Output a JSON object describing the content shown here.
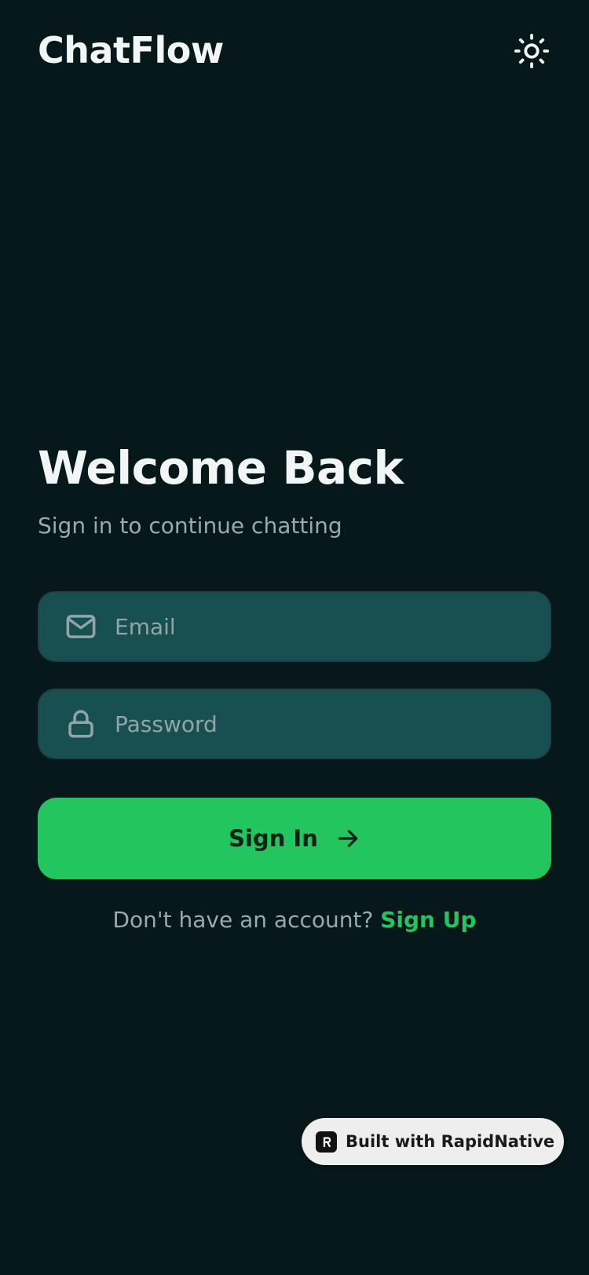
{
  "header": {
    "app_title": "ChatFlow",
    "theme_icon": "sun-icon"
  },
  "welcome": {
    "title": "Welcome Back",
    "subtitle": "Sign in to continue chatting"
  },
  "form": {
    "email": {
      "placeholder": "Email",
      "value": "",
      "icon": "mail-icon"
    },
    "password": {
      "placeholder": "Password",
      "value": "",
      "icon": "lock-icon"
    },
    "submit_label": "Sign In",
    "submit_icon": "arrow-right-icon"
  },
  "signup": {
    "prompt": "Don't have an account?",
    "link_label": "Sign Up"
  },
  "badge": {
    "label": "Built with RapidNative",
    "icon": "rapidnative-logo-icon"
  },
  "colors": {
    "background": "#06181a",
    "input_background": "#184f50",
    "accent": "#22c55e",
    "text_primary": "#f2f5f5",
    "text_secondary": "#9ba9ae"
  }
}
